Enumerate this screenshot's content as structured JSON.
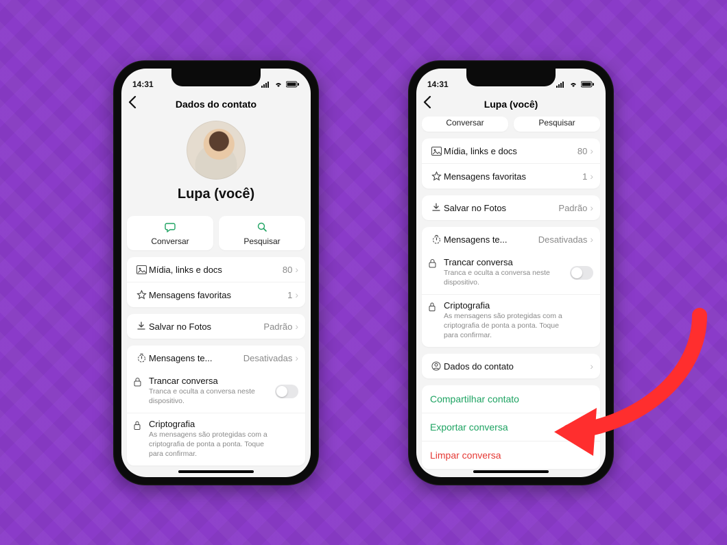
{
  "status": {
    "time": "14:31"
  },
  "left": {
    "header_title": "Dados do contato",
    "contact_name": "Lupa (você)",
    "actions": {
      "chat": "Conversar",
      "search": "Pesquisar"
    },
    "media": {
      "label": "Mídia, links e docs",
      "count": "80"
    },
    "starred": {
      "label": "Mensagens favoritas",
      "count": "1"
    },
    "save_photos": {
      "label": "Salvar no Fotos",
      "value": "Padrão"
    },
    "temp_msgs": {
      "label": "Mensagens te...",
      "value": "Desativadas"
    },
    "lock": {
      "title": "Trancar conversa",
      "desc": "Tranca e oculta a conversa neste dispositivo."
    },
    "crypto": {
      "title": "Criptografia",
      "desc": "As mensagens são protegidas com a criptografia de ponta a ponta. Toque para confirmar."
    }
  },
  "right": {
    "header_title": "Lupa (você)",
    "actions": {
      "chat": "Conversar",
      "search": "Pesquisar"
    },
    "media": {
      "label": "Mídia, links e docs",
      "count": "80"
    },
    "starred": {
      "label": "Mensagens favoritas",
      "count": "1"
    },
    "save_photos": {
      "label": "Salvar no Fotos",
      "value": "Padrão"
    },
    "temp_msgs": {
      "label": "Mensagens te...",
      "value": "Desativadas"
    },
    "lock": {
      "title": "Trancar conversa",
      "desc": "Tranca e oculta a conversa neste dispositivo."
    },
    "crypto": {
      "title": "Criptografia",
      "desc": "As mensagens são protegidas com a criptografia de ponta a ponta. Toque para confirmar."
    },
    "contact_details": "Dados do contato",
    "share": "Compartilhar contato",
    "export": "Exportar conversa",
    "clear": "Limpar conversa"
  }
}
